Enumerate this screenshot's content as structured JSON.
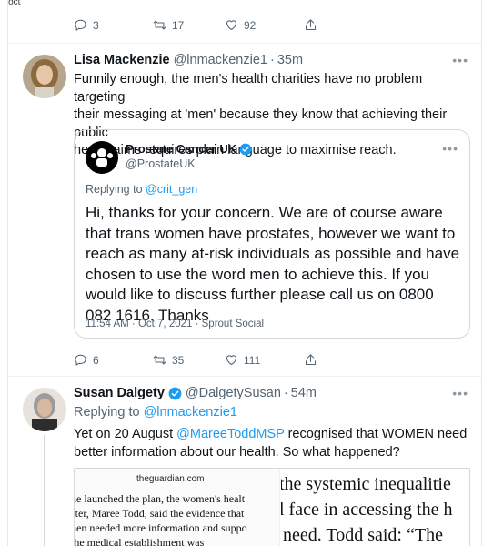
{
  "edge_text": "Foct",
  "top_actions": {
    "replies": "3",
    "retweets": "17",
    "likes": "92"
  },
  "tweet1": {
    "name": "Lisa Mackenzie",
    "handle": "@lnmackenzie1",
    "dot": "·",
    "time": "35m",
    "more": "•••",
    "text_line1": "Funnily enough, the men's health charities have no problem targeting",
    "text_line2": "their messaging at 'men' because they know that achieving their public",
    "text_line3": "health aims requires plain language to maximise reach.",
    "quote": {
      "name": "Prostate Cancer UK",
      "handle": "@ProstateUK",
      "more": "•••",
      "replying_prefix": "Replying to ",
      "replying_to": "@crit_gen",
      "lines": [
        "Hi, thanks for your concern. We are of course aware",
        "that trans women have prostates, however we want to",
        "reach as many at-risk individuals as possible and have",
        "chosen to use the word men to achieve this. If you",
        "would like to discuss further please call us on 0800",
        "082 1616. Thanks"
      ],
      "meta": "11:54 AM · Oct 7, 2021 · Sprout Social"
    },
    "actions": {
      "replies": "6",
      "retweets": "35",
      "likes": "111"
    }
  },
  "tweet2": {
    "name": "Susan Dalgety",
    "handle": "@DalgetySusan",
    "dot": "·",
    "time": "54m",
    "more": "•••",
    "replying_prefix": "Replying to ",
    "replying_to": "@lnmackenzie1",
    "text_line1_pre": "Yet on 20 August ",
    "text_line1_mention": "@MareeToddMSP",
    "text_line1_post": " recognised that WOMEN need",
    "text_line2": "better information about our health. So what happened?",
    "card": {
      "domain": "theguardian.com",
      "left_lines": [
        "ne launched the plan, the women's healt",
        "ster, Maree Todd, said the evidence that",
        "nen needed more information and suppo",
        "the medical establishment was"
      ],
      "right_lines": [
        "the systemic inequalitie",
        "l face in accessing the h",
        "need. Todd said: “The"
      ]
    }
  },
  "colors": {
    "accent": "#1d9bf0",
    "verified": "#1d9bf0",
    "muted": "#536471"
  }
}
